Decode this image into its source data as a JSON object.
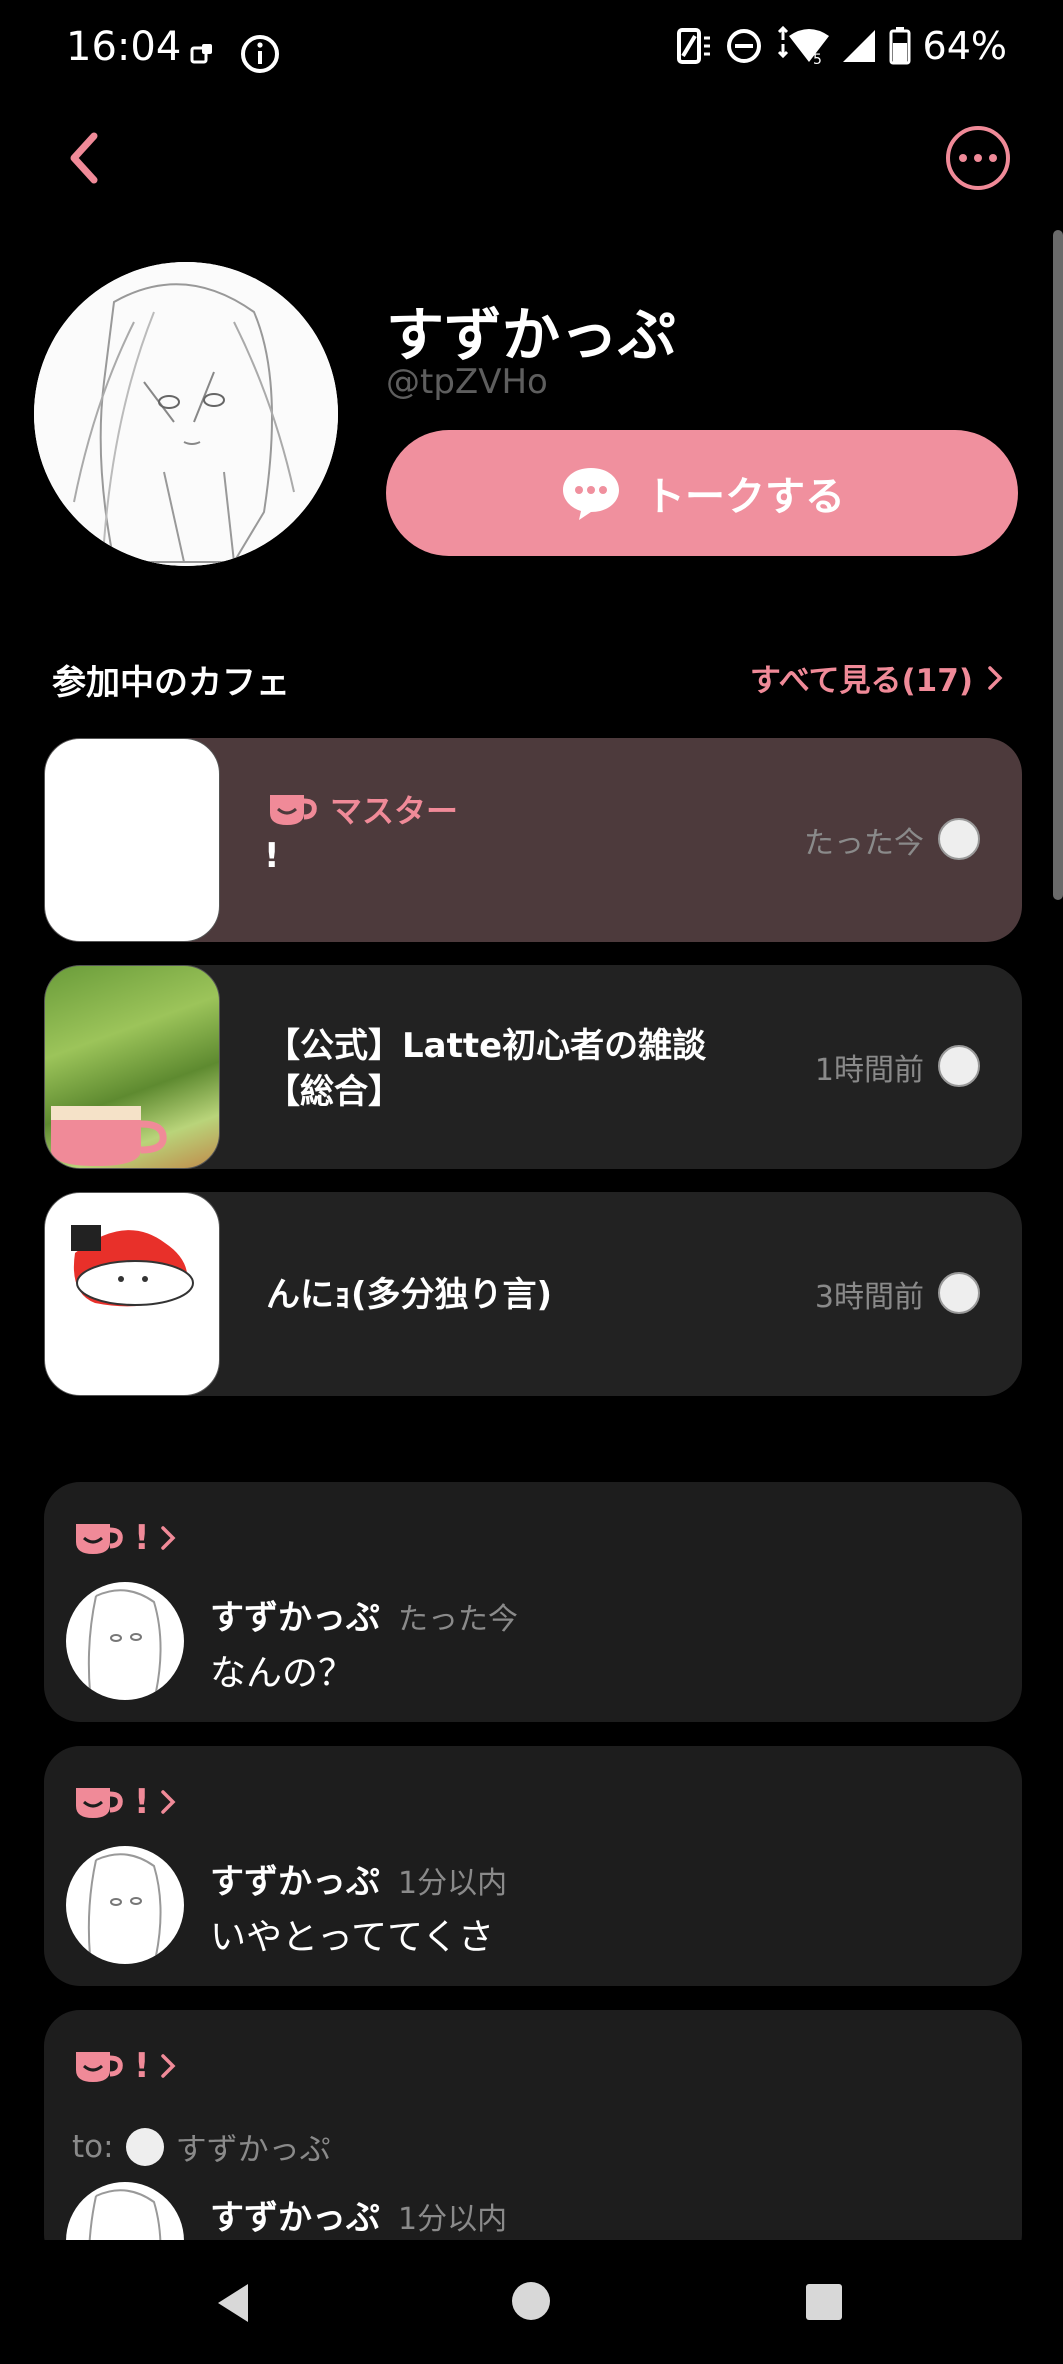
{
  "status_bar": {
    "time": "16:04",
    "battery": "64%"
  },
  "header": {
    "back_icon": "chevron-left-icon",
    "more_icon": "more-horizontal-icon"
  },
  "profile": {
    "name": "すずかっぷ",
    "handle": "@tpZVHo",
    "talk_label": "トークする"
  },
  "cafes_section": {
    "title": "参加中のカフェ",
    "see_all": "すべて見る(17)"
  },
  "cafes": [
    {
      "role": "マスター",
      "message": "!",
      "time": "たった今",
      "highlighted": true
    },
    {
      "name_line1": "【公式】Latte初心者の雑談",
      "name_line2": "【総合】",
      "time": "1時間前"
    },
    {
      "name": "んにｮ(多分独り言)",
      "time": "3時間前"
    }
  ],
  "posts": [
    {
      "cafe": "!",
      "author": "すずかっぷ",
      "time": "たった今",
      "text": "なんの？"
    },
    {
      "cafe": "!",
      "author": "すずかっぷ",
      "time": "1分以内",
      "text": "いやとっててくさ"
    },
    {
      "cafe": "!",
      "to_label": "to:",
      "to_name": "すずかっぷ",
      "author": "すずかっぷ",
      "time": "1分以内"
    }
  ],
  "colors": {
    "accent": "#f08a98",
    "background": "#000000",
    "card": "#1d1d1d",
    "active_card": "#4d3a3c"
  }
}
